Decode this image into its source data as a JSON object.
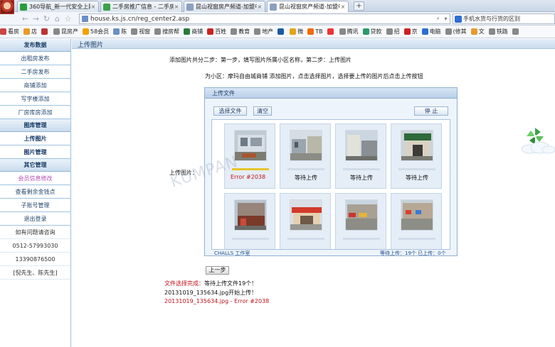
{
  "browser": {
    "tabs": [
      {
        "label": "360导航_新一代安全上网导航",
        "icon_color": "#2a9d3c",
        "active": false
      },
      {
        "label": "二手房推广信息 - 二手房",
        "icon_color": "#3aa34a",
        "active": false
      },
      {
        "label": "昆山视窗房产频道-加盟中介",
        "icon_color": "#8aa0c0",
        "active": false
      },
      {
        "label": "昆山视窗房产频道-加盟中介",
        "icon_color": "#8aa0c0",
        "active": true
      }
    ],
    "new_tab_symbol": "+",
    "url": "house.ks.js.cn/reg_center2.asp",
    "search_text": "手机水货与行货的区别",
    "bookmarks": [
      {
        "label": "看房",
        "color": "#c44"
      },
      {
        "label": "店",
        "color": "#e89b2c"
      },
      {
        "label": "",
        "color": "#b33"
      },
      {
        "label": "昆房产",
        "color": "#888"
      },
      {
        "label": "58会员",
        "color": "#f2a200"
      },
      {
        "label": "陈",
        "color": "#6a8fc6"
      },
      {
        "label": "视窗",
        "color": "#888"
      },
      {
        "label": "搜房帮",
        "color": "#888"
      },
      {
        "label": "商铺",
        "color": "#2b7a3a"
      },
      {
        "label": "百姓",
        "color": "#c22"
      },
      {
        "label": "教育",
        "color": "#888"
      },
      {
        "label": "地产",
        "color": "#888"
      },
      {
        "label": "",
        "color": "#1a5aa8"
      },
      {
        "label": "微",
        "color": "#e6a21b"
      },
      {
        "label": "TB",
        "color": "#f26a0a"
      },
      {
        "label": "",
        "color": "#e33"
      },
      {
        "label": "腾讯",
        "color": "#888"
      },
      {
        "label": "贷款",
        "color": "#2b9a6b"
      },
      {
        "label": "招",
        "color": "#888"
      },
      {
        "label": "京",
        "color": "#c22"
      },
      {
        "label": "电脑",
        "color": "#2a6fcf"
      },
      {
        "label": "(修其",
        "color": "#888"
      },
      {
        "label": "文",
        "color": "#e89b2c"
      },
      {
        "label": "铁路",
        "color": "#888"
      },
      {
        "label": "",
        "color": "#888"
      }
    ]
  },
  "sidebar": {
    "sections": [
      {
        "kind": "head",
        "label": "发布数据"
      },
      {
        "kind": "item",
        "label": "出租房发布"
      },
      {
        "kind": "item",
        "label": "二手房发布"
      },
      {
        "kind": "item",
        "label": "商铺添加"
      },
      {
        "kind": "item",
        "label": "写字楼添加"
      },
      {
        "kind": "item",
        "label": "厂房库房添加"
      },
      {
        "kind": "head",
        "label": "图库管理"
      },
      {
        "kind": "item-bold",
        "label": "上传图片"
      },
      {
        "kind": "item-bold",
        "label": "图片管理"
      },
      {
        "kind": "head",
        "label": "其它管理"
      },
      {
        "kind": "item-pink",
        "label": "会员信息修改"
      },
      {
        "kind": "item",
        "label": "查看剩余金钱点"
      },
      {
        "kind": "item",
        "label": "子账号管理"
      },
      {
        "kind": "item",
        "label": "退出登录"
      },
      {
        "kind": "plain",
        "label": "如有问题请咨询"
      },
      {
        "kind": "plain",
        "label": "0512-57993030"
      },
      {
        "kind": "plain",
        "label": "13390876500"
      },
      {
        "kind": "plain",
        "label": "[倪先生、陈先生]"
      }
    ]
  },
  "main": {
    "header_title": "上传图片",
    "instructions": "添加图片共分二步：第一步，填写图片所属小区名称，第二步：上传图片",
    "target_line": "为小区：摩玛自由城商铺 添加图片，点击选择图片，选择要上传的图片后点击上传按钮",
    "upload_label": "上传图片：",
    "watermark": "KUMPAN",
    "uploader": {
      "title": "上传文件",
      "select_btn": "选择文件",
      "clear_btn": "清空",
      "stop_btn": "停 止",
      "footer_left": "CHALLS 工作室",
      "footer_right": "等待上传：19个  已上传：0个",
      "files": [
        {
          "status": "Error #2038",
          "error": true,
          "scene": "building"
        },
        {
          "status": "等待上传",
          "error": false,
          "scene": "street"
        },
        {
          "status": "等待上传",
          "error": false,
          "scene": "corner"
        },
        {
          "status": "等待上传",
          "error": false,
          "scene": "gate"
        },
        {
          "status": "",
          "error": false,
          "scene": "shops"
        },
        {
          "status": "",
          "error": false,
          "scene": "storefront"
        },
        {
          "status": "",
          "error": false,
          "scene": "market"
        },
        {
          "status": "",
          "error": false,
          "scene": "arcade"
        }
      ]
    },
    "prev_button": "上一步",
    "log": [
      {
        "prefix": "文件选择完成：",
        "text": "等待上传文件19个！",
        "red_prefix": true
      },
      {
        "prefix": "",
        "text": "20131019_135634.jpg开始上传！",
        "red_prefix": false
      },
      {
        "prefix": "",
        "text": "20131019_135634.jpg - Error #2038",
        "red_prefix": false,
        "red": true
      }
    ]
  },
  "colors": {
    "sidebar_border": "#9cc4e2",
    "accent_blue": "#1a3c66",
    "error_red": "#c0141a"
  }
}
